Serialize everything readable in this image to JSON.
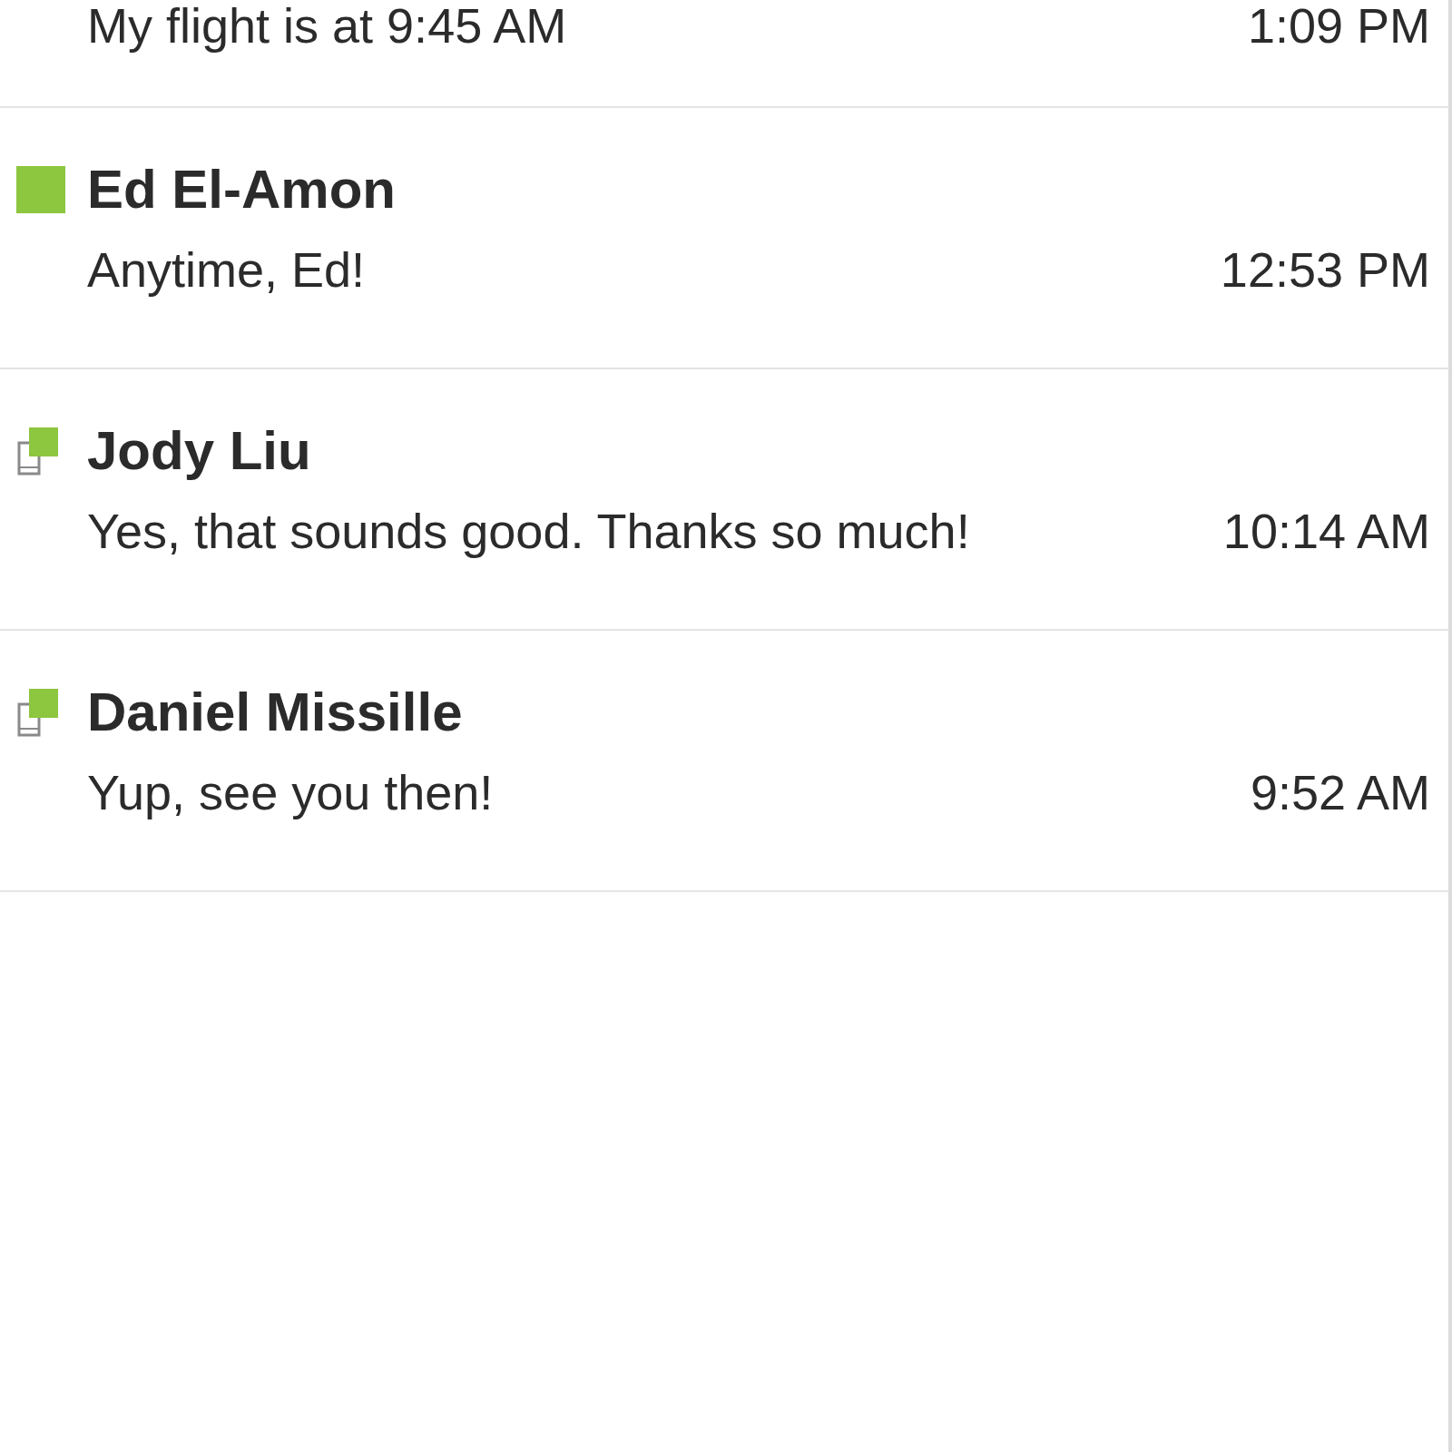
{
  "conversations": [
    {
      "kind": "none",
      "message": "My flight is at 9:45 AM",
      "time": "1:09 PM"
    },
    {
      "kind": "available",
      "name": "Ed El-Amon",
      "message": "Anytime, Ed!",
      "time": "12:53 PM"
    },
    {
      "kind": "mobile",
      "name": "Jody Liu",
      "message": "Yes, that sounds good. Thanks so much!",
      "time": "10:14 AM"
    },
    {
      "kind": "mobile",
      "name": "Daniel Missille",
      "message": "Yup, see you then!",
      "time": "9:52 AM"
    }
  ]
}
